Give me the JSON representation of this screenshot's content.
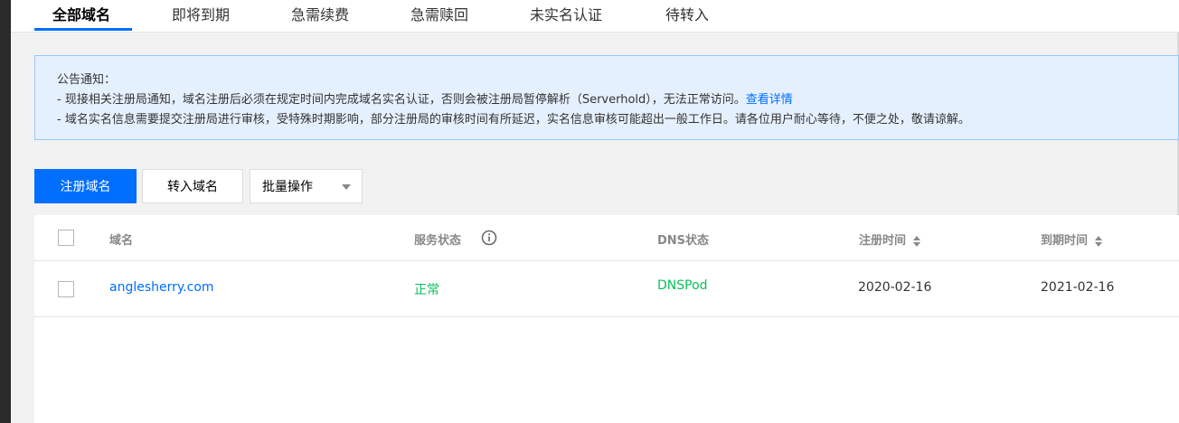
{
  "tabs": [
    "全部域名",
    "即将到期",
    "急需续费",
    "急需赎回",
    "未实名认证",
    "待转入"
  ],
  "notice": {
    "title": "公告通知：",
    "line1": "- 现接相关注册局通知，域名注册后必须在规定时间内完成域名实名认证，否则会被注册局暂停解析（Serverhold），无法正常访问。",
    "line1_link": "查看详情",
    "line2": "- 域名实名信息需要提交注册局进行审核，受特殊时期影响，部分注册局的审核时间有所延迟，实名信息审核可能超出一般工作日。请各位用户耐心等待，不便之处，敬请谅解。"
  },
  "toolbar": {
    "register_label": "注册域名",
    "transfer_label": "转入域名",
    "batch_label": "批量操作"
  },
  "table": {
    "headers": {
      "domain": "域名",
      "service_status": "服务状态",
      "dns_status": "DNS状态",
      "register_time": "注册时间",
      "expire_time": "到期时间"
    },
    "rows": [
      {
        "domain": "anglesherry.com",
        "service_status": "正常",
        "dns_status": "DNSPod",
        "register_time": "2020-02-16",
        "expire_time": "2021-02-16"
      }
    ]
  },
  "colors": {
    "accent": "#006eff",
    "success": "#0abf5b",
    "notice_bg": "#e5f0ff",
    "notice_border": "#97c7ff"
  }
}
